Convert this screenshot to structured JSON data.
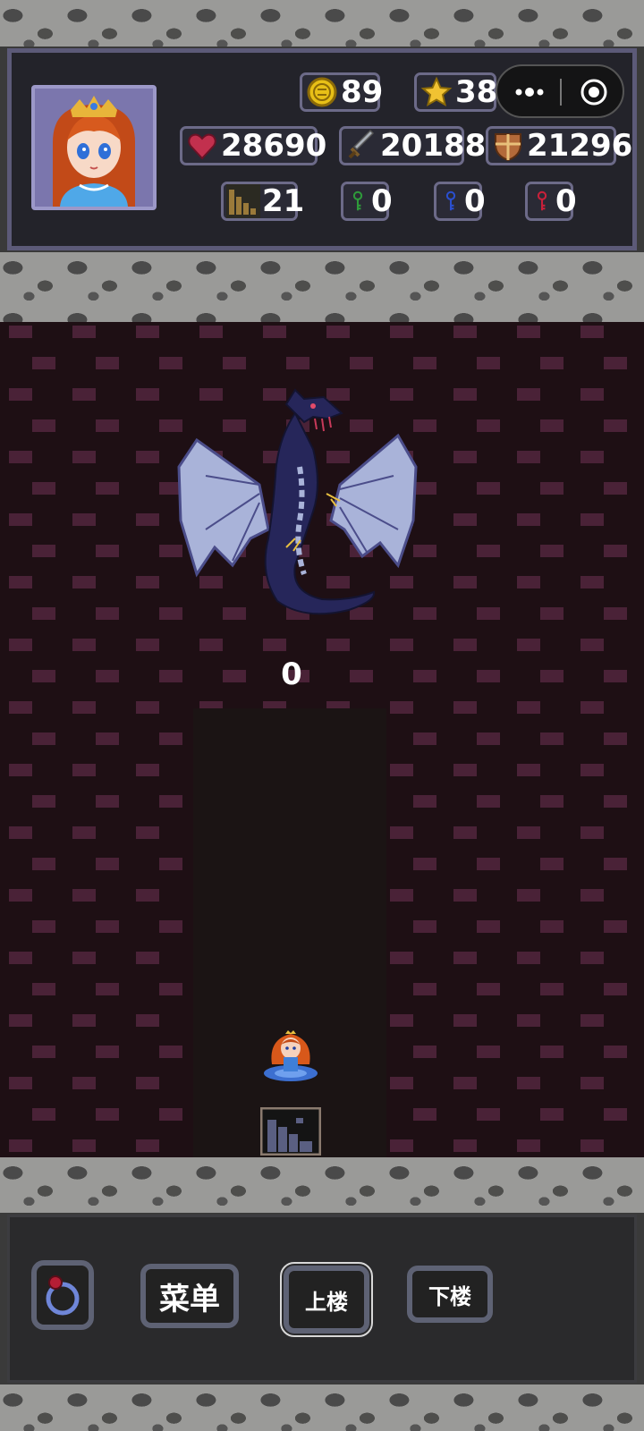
{
  "hud": {
    "gold": "89",
    "stars": "38",
    "hp": "28690",
    "attack": "20188",
    "defense": "21296",
    "floor": "21",
    "green_keys": "0",
    "blue_keys": "0",
    "red_keys": "0"
  },
  "icons": {
    "gold": "coin-icon",
    "stars": "star-icon",
    "hp": "heart-icon",
    "attack": "sword-icon",
    "defense": "shield-icon",
    "floor": "stairs-icon",
    "green_key": "green-key-icon",
    "blue_key": "blue-key-icon",
    "red_key": "red-key-icon",
    "more": "more-icon",
    "target": "target-icon",
    "ring": "ring-icon"
  },
  "board": {
    "damage_value": "0",
    "enemy": "dragon",
    "player": "princess",
    "tile": "stairs-up"
  },
  "controls": {
    "menu_label": "菜单",
    "up_label": "上楼",
    "down_label": "下楼"
  },
  "colors": {
    "board_bg": "#1e0f14",
    "brick": "#4a2237",
    "hud_border": "#5c5a78",
    "key_green": "#2e9a3a",
    "key_blue": "#2a4fcf",
    "key_red": "#c9203a"
  }
}
